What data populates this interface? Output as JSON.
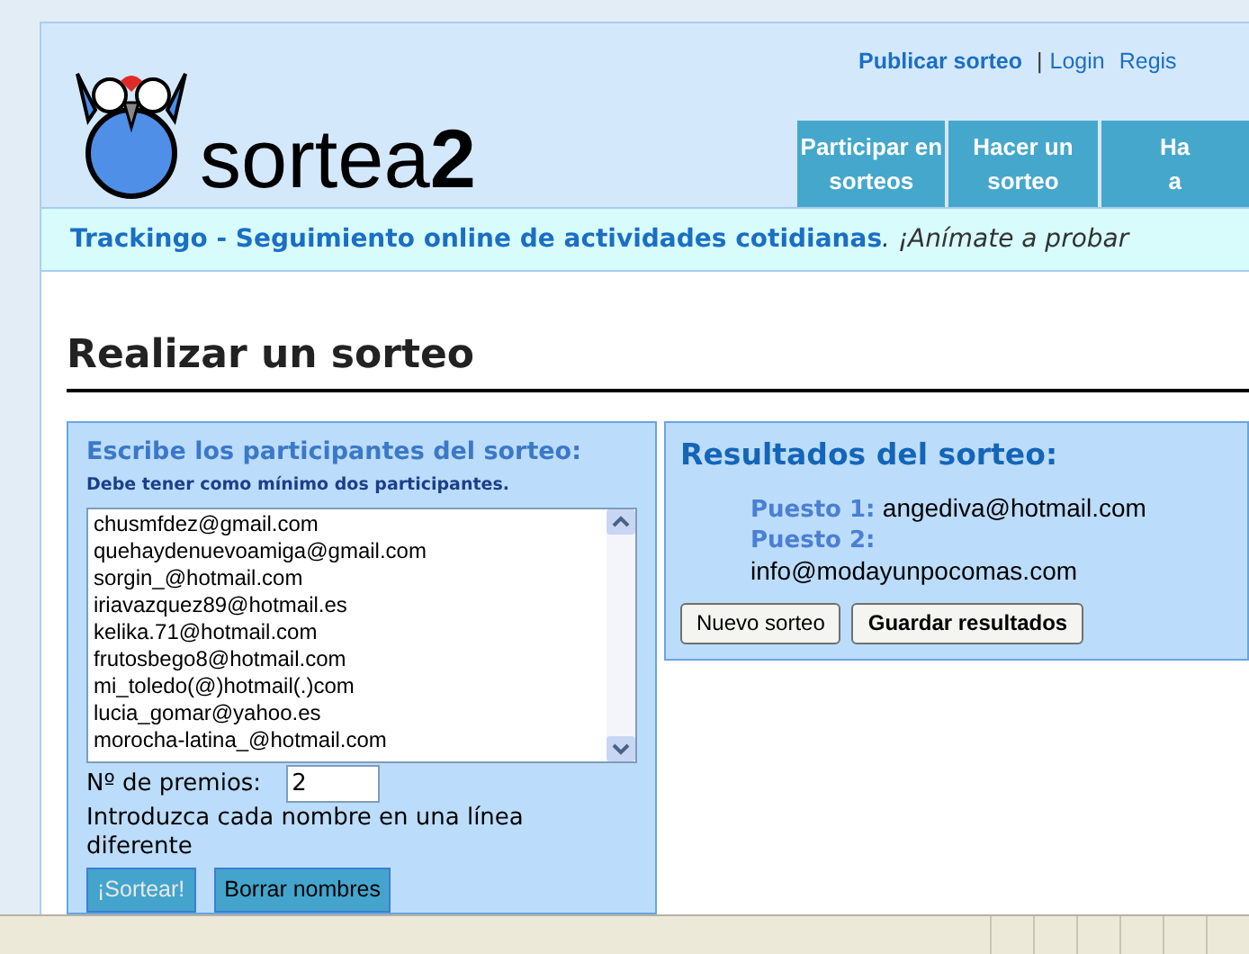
{
  "top_links": [
    {
      "label": "Publicar sorteo",
      "bold": true,
      "kind": "link"
    },
    {
      "label": "|",
      "bold": false,
      "kind": "separator"
    },
    {
      "label": "Login",
      "bold": false,
      "kind": "link"
    },
    {
      "label": "Regis",
      "bold": false,
      "kind": "link"
    }
  ],
  "logo": {
    "text": "sortea",
    "suffix": "2"
  },
  "nav_tabs": [
    {
      "lines": [
        "Participar en",
        "sorteos"
      ]
    },
    {
      "lines": [
        "Hacer un",
        "sorteo"
      ]
    },
    {
      "lines": [
        "Ha",
        "a"
      ]
    }
  ],
  "banner": {
    "link": "Trackingo - Seguimiento online de actividades cotidianas",
    "text": ". ¡Anímate a probar"
  },
  "heading": "Realizar un sorteo",
  "participants_panel": {
    "title": "Escribe los participantes del sorteo:",
    "note": "Debe tener como mínimo dos participantes.",
    "entries": [
      "chusmfdez@gmail.com",
      "quehaydenuevoamiga@gmail.com",
      "sorgin_@hotmail.com",
      "iriavazquez89@hotmail.es",
      "kelika.71@hotmail.com",
      "frutosbego8@hotmail.com",
      "mi_toledo(@)hotmail(.)com",
      "lucia_gomar@yahoo.es",
      "morocha-latina_@hotmail.com"
    ],
    "prizes_label": "Nº de premios:",
    "prizes_value": "2",
    "hint": "Introduzca cada nombre en una línea diferente",
    "buttons": [
      {
        "label": "¡Sortear!",
        "disabled": true
      },
      {
        "label": "Borrar nombres",
        "disabled": false
      }
    ]
  },
  "results_panel": {
    "title": "Resultados del sorteo:",
    "results": [
      {
        "label": "Puesto 1:",
        "value": "angediva@hotmail.com"
      },
      {
        "label": "Puesto 2:",
        "value": "info@modayunpocomas.com"
      }
    ],
    "buttons": [
      {
        "label": "Nuevo sorteo",
        "bold": false
      },
      {
        "label": "Guardar resultados",
        "bold": true
      }
    ]
  }
}
